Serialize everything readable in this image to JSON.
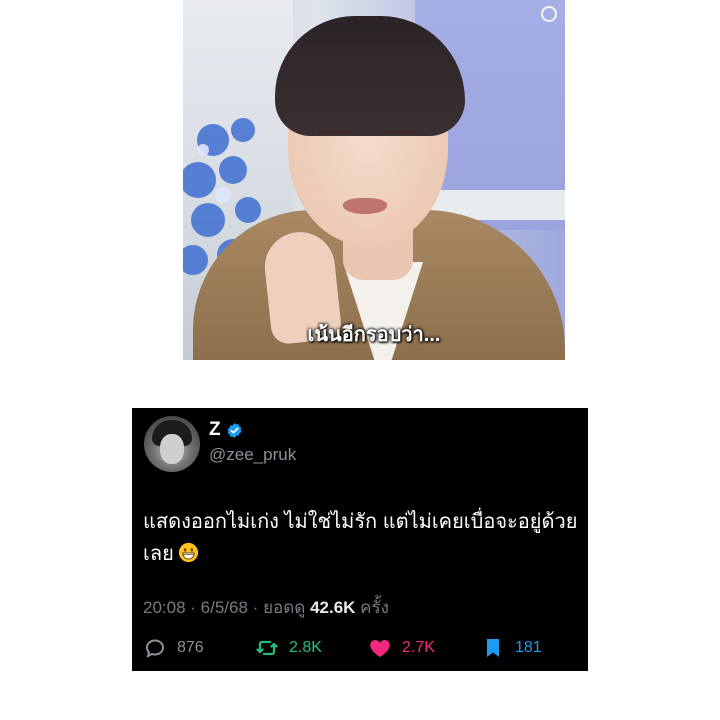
{
  "video": {
    "subtitle": "เน้นอีกรอบว่า..."
  },
  "tweet": {
    "display_name": "Z",
    "handle": "@zee_pruk",
    "text_line1": "แสดงออกไม่เก่ง ไม่ใช่ไม่รัก แต่ไม่เคยเบื่อจะอยู่ด้วย",
    "text_line2": "เลย",
    "emoji": "grinning-face-emoji",
    "time": "20:08",
    "date": "6/5/68",
    "views_label": "ยอดดู",
    "views_count": "42.6K",
    "views_suffix": "ครั้ง",
    "replies": "876",
    "retweets": "2.8K",
    "likes": "2.7K",
    "bookmarks": "181"
  },
  "colors": {
    "card_bg": "#000000",
    "retweet": "#20c27a",
    "like": "#f5277d",
    "bookmark": "#1d9bf0",
    "verified": "#1d9bf0"
  },
  "icons": [
    "reply-icon",
    "retweet-icon",
    "heart-icon",
    "bookmark-icon",
    "verified-badge-icon"
  ]
}
